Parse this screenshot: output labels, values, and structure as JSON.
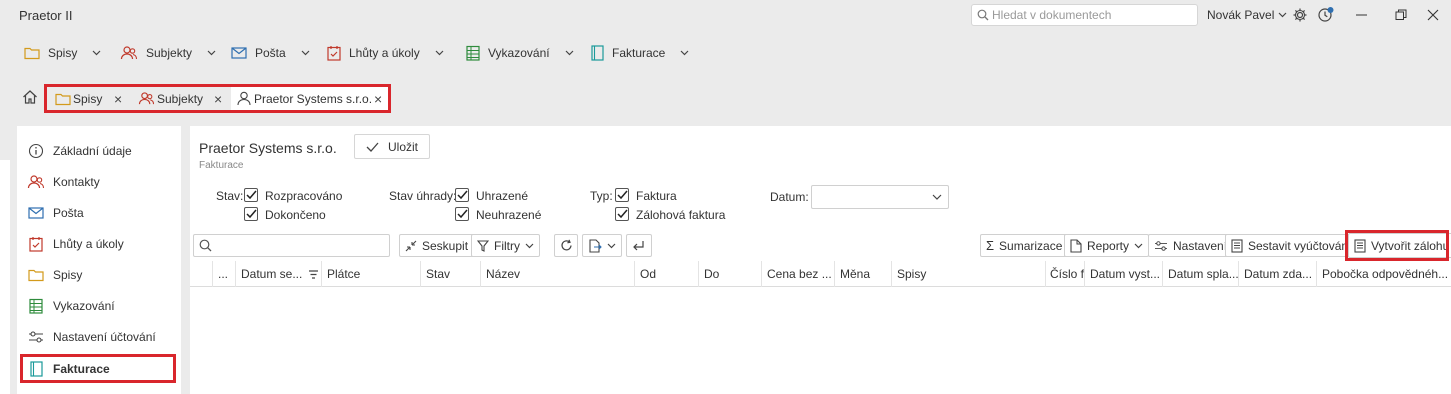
{
  "app": {
    "title": "Praetor II",
    "search_placeholder": "Hledat v dokumentech",
    "user": "Novák Pavel"
  },
  "menu": [
    {
      "label": "Spisy",
      "icon": "folder-icon"
    },
    {
      "label": "Subjekty",
      "icon": "people-icon"
    },
    {
      "label": "Pošta",
      "icon": "envelope-icon"
    },
    {
      "label": "Lhůty a úkoly",
      "icon": "calendar-check-icon"
    },
    {
      "label": "Vykazování",
      "icon": "timesheet-icon"
    },
    {
      "label": "Fakturace",
      "icon": "invoice-icon"
    }
  ],
  "tabs": [
    {
      "label": "Spisy",
      "icon": "folder-icon"
    },
    {
      "label": "Subjekty",
      "icon": "people-icon"
    },
    {
      "label": "Praetor Systems s.r.o.",
      "icon": "person-icon",
      "active": true
    }
  ],
  "sidebar": {
    "items": [
      {
        "label": "Základní údaje",
        "icon": "info-icon"
      },
      {
        "label": "Kontakty",
        "icon": "people-icon"
      },
      {
        "label": "Pošta",
        "icon": "envelope-icon"
      },
      {
        "label": "Lhůty a úkoly",
        "icon": "calendar-check-icon"
      },
      {
        "label": "Spisy",
        "icon": "folder-icon"
      },
      {
        "label": "Vykazování",
        "icon": "timesheet-icon"
      },
      {
        "label": "Nastavení účtování",
        "icon": "sliders-icon"
      },
      {
        "label": "Fakturace",
        "icon": "invoice-icon",
        "active": true
      }
    ]
  },
  "main": {
    "title": "Praetor Systems s.r.o.",
    "subtitle": "Fakturace",
    "save_label": "Uložit"
  },
  "filters": {
    "stav_label": "Stav:",
    "stav": [
      {
        "label": "Rozpracováno",
        "checked": true
      },
      {
        "label": "Dokončeno",
        "checked": true
      }
    ],
    "uhrada_label": "Stav úhrady:",
    "uhrada": [
      {
        "label": "Uhrazené",
        "checked": true
      },
      {
        "label": "Neuhrazené",
        "checked": true
      }
    ],
    "typ_label": "Typ:",
    "typ": [
      {
        "label": "Faktura",
        "checked": true
      },
      {
        "label": "Zálohová faktura",
        "checked": true
      }
    ],
    "datum_label": "Datum:",
    "datum_value": ""
  },
  "toolbar": {
    "group": "Seskupit",
    "filters": "Filtry",
    "summarize": "Sumarizace",
    "reports": "Reporty",
    "settings": "Nastavení",
    "build_billing": "Sestavit vyúčtování",
    "create_advance": "Vytvořit zálohu"
  },
  "columns": [
    "...",
    "Datum se...",
    "Plátce",
    "Stav",
    "Název",
    "Od",
    "Do",
    "Cena bez ...",
    "Měna",
    "Spisy",
    "Číslo fak...",
    "Datum vyst...",
    "Datum spla...",
    "Datum zda...",
    "Pobočka odpovědnéh..."
  ],
  "colors": {
    "highlight": "#d9262c",
    "accent": "#2f6fb0"
  }
}
